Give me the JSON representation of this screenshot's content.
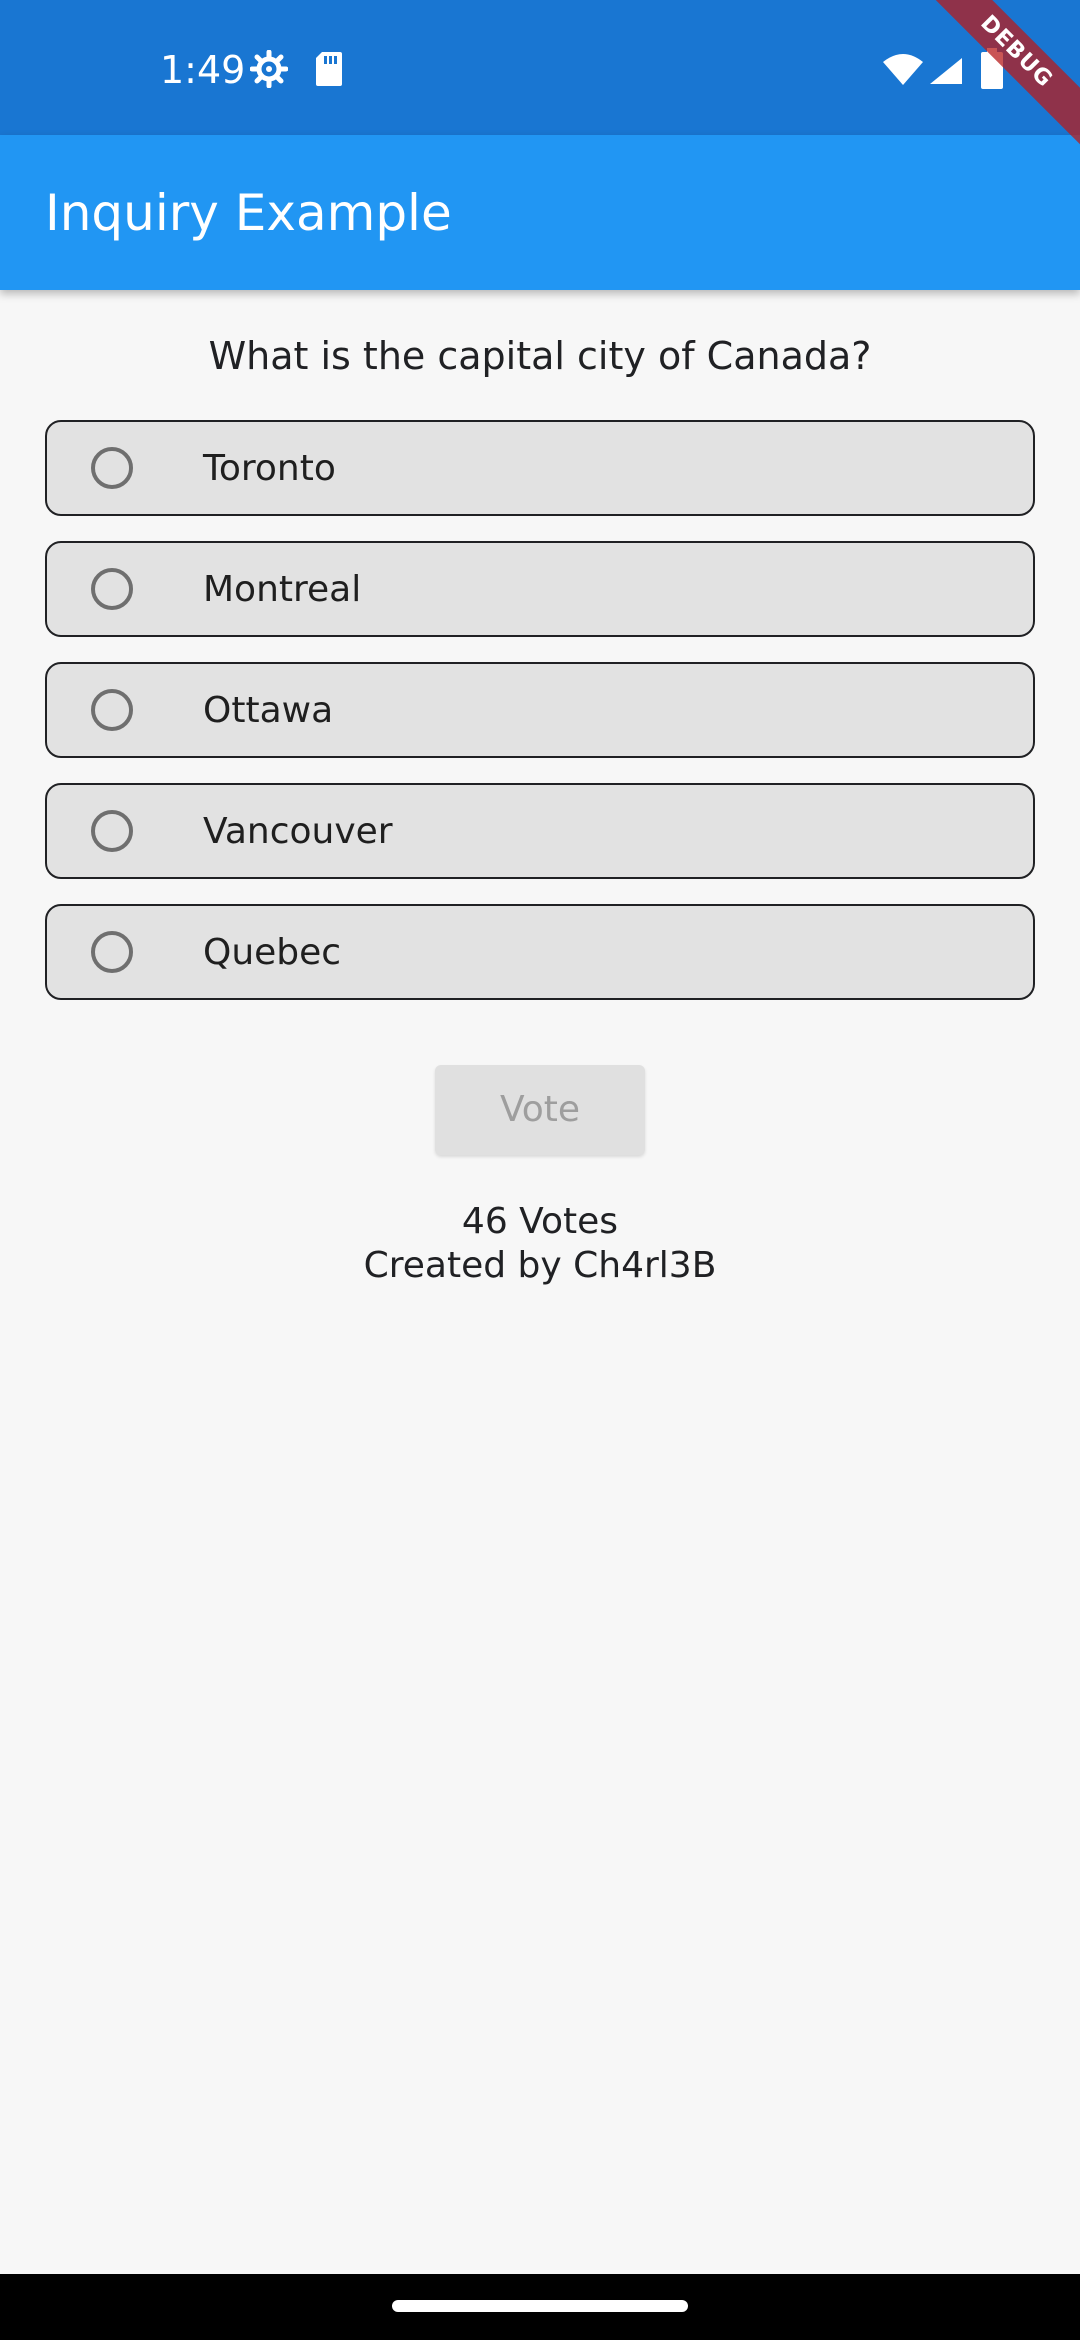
{
  "status_bar": {
    "time": "1:49",
    "background": "#1976d2",
    "icons": [
      "gear-icon",
      "sd-card-icon",
      "wifi-icon",
      "signal-icon",
      "battery-icon"
    ]
  },
  "debug_banner": {
    "label": "DEBUG"
  },
  "app_bar": {
    "title": "Inquiry Example",
    "background": "#2196f3"
  },
  "poll": {
    "question": "What is the capital city of Canada?",
    "options": [
      {
        "label": "Toronto",
        "selected": false
      },
      {
        "label": "Montreal",
        "selected": false
      },
      {
        "label": "Ottawa",
        "selected": false
      },
      {
        "label": "Vancouver",
        "selected": false
      },
      {
        "label": "Quebec",
        "selected": false
      }
    ],
    "vote_label": "Vote",
    "vote_enabled": false,
    "votes_text": "46 Votes",
    "creator_text": "Created by Ch4rl3B"
  }
}
